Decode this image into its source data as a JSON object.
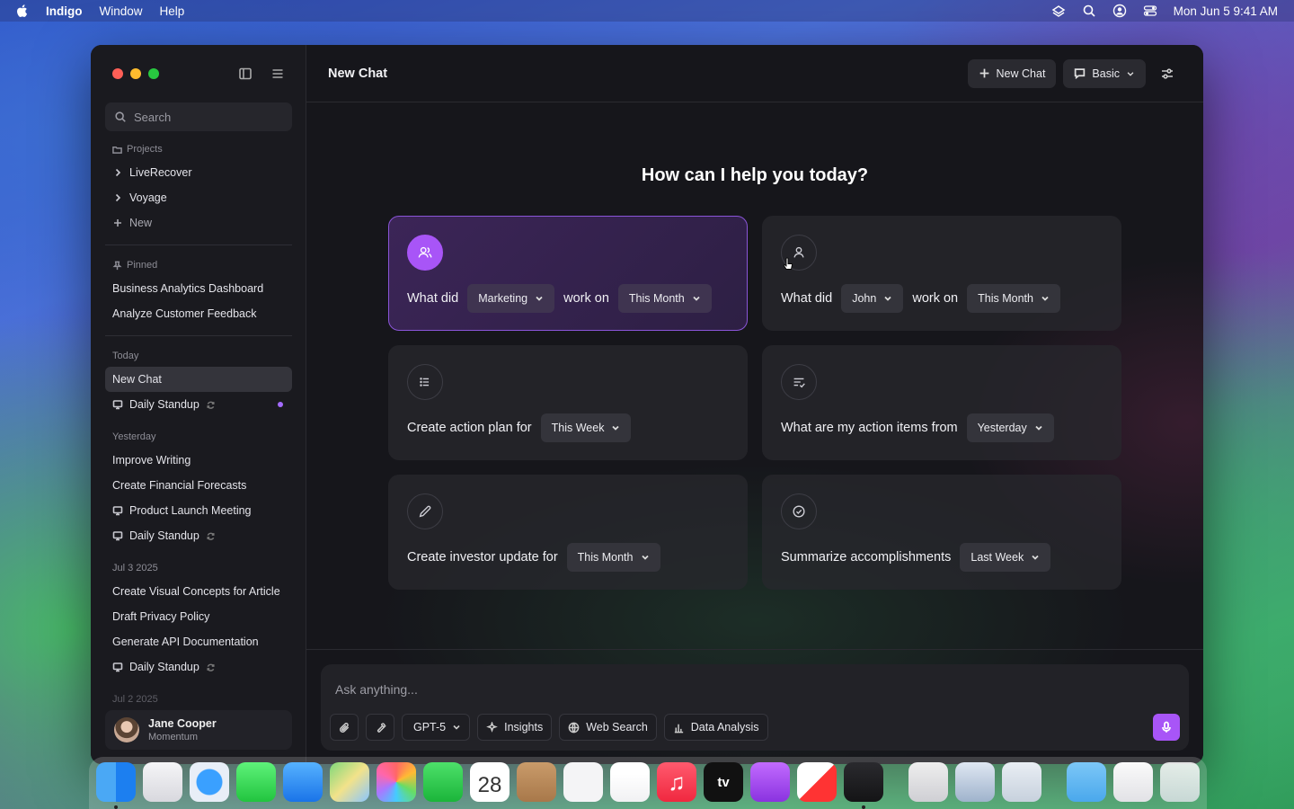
{
  "menubar": {
    "app_name": "Indigo",
    "menus": [
      "Window",
      "Help"
    ],
    "clock": "Mon Jun 5  9:41 AM"
  },
  "sidebar": {
    "search_placeholder": "Search",
    "projects_label": "Projects",
    "projects": [
      "LiveRecover",
      "Voyage"
    ],
    "new_label": "New",
    "pinned_label": "Pinned",
    "pinned": [
      "Business Analytics Dashboard",
      "Analyze Customer Feedback"
    ],
    "today_label": "Today",
    "today": [
      {
        "label": "New Chat",
        "active": true
      },
      {
        "label": "Daily Standup",
        "meeting": true,
        "recurring": true,
        "unread": true
      }
    ],
    "yesterday_label": "Yesterday",
    "yesterday": [
      {
        "label": "Improve Writing"
      },
      {
        "label": "Create Financial Forecasts"
      },
      {
        "label": "Product Launch Meeting",
        "meeting": true
      },
      {
        "label": "Daily Standup",
        "meeting": true,
        "recurring": true
      }
    ],
    "jul3_label": "Jul 3 2025",
    "jul3": [
      {
        "label": "Create Visual Concepts for Article"
      },
      {
        "label": "Draft Privacy Policy"
      },
      {
        "label": "Generate API Documentation"
      },
      {
        "label": "Daily Standup",
        "meeting": true,
        "recurring": true
      }
    ],
    "jul2_label": "Jul 2 2025",
    "user": {
      "name": "Jane Cooper",
      "org": "Momentum"
    }
  },
  "header": {
    "title": "New Chat",
    "new_chat_label": "New Chat",
    "mode_label": "Basic"
  },
  "main": {
    "greeting": "How can I help you today?",
    "cards": [
      {
        "icon": "users-icon",
        "selected": true,
        "parts": [
          "What did",
          {
            "pill": "Marketing"
          },
          "work on",
          {
            "pill": "This Month"
          }
        ]
      },
      {
        "icon": "user-icon",
        "selected": false,
        "parts": [
          "What did",
          {
            "pill": "John"
          },
          "work on",
          {
            "pill": "This Month"
          }
        ]
      },
      {
        "icon": "list-icon",
        "selected": false,
        "parts": [
          "Create action plan for",
          {
            "pill": "This Week"
          }
        ]
      },
      {
        "icon": "list-check-icon",
        "selected": false,
        "parts": [
          "What are my action items from",
          {
            "pill": "Yesterday"
          }
        ]
      },
      {
        "icon": "pencil-icon",
        "selected": false,
        "parts": [
          "Create investor update for",
          {
            "pill": "This Month"
          }
        ]
      },
      {
        "icon": "check-circle-icon",
        "selected": false,
        "parts": [
          "Summarize accomplishments",
          {
            "pill": "Last Week"
          }
        ]
      }
    ]
  },
  "composer": {
    "placeholder": "Ask anything...",
    "model_label": "GPT-5",
    "insights_label": "Insights",
    "web_search_label": "Web Search",
    "data_analysis_label": "Data Analysis"
  },
  "dock": {
    "calendar_day": "28",
    "tv_label": "tv"
  },
  "colors": {
    "accent": "#a855f7",
    "accent_border": "#8a55d8",
    "window_bg": "#16161b"
  }
}
